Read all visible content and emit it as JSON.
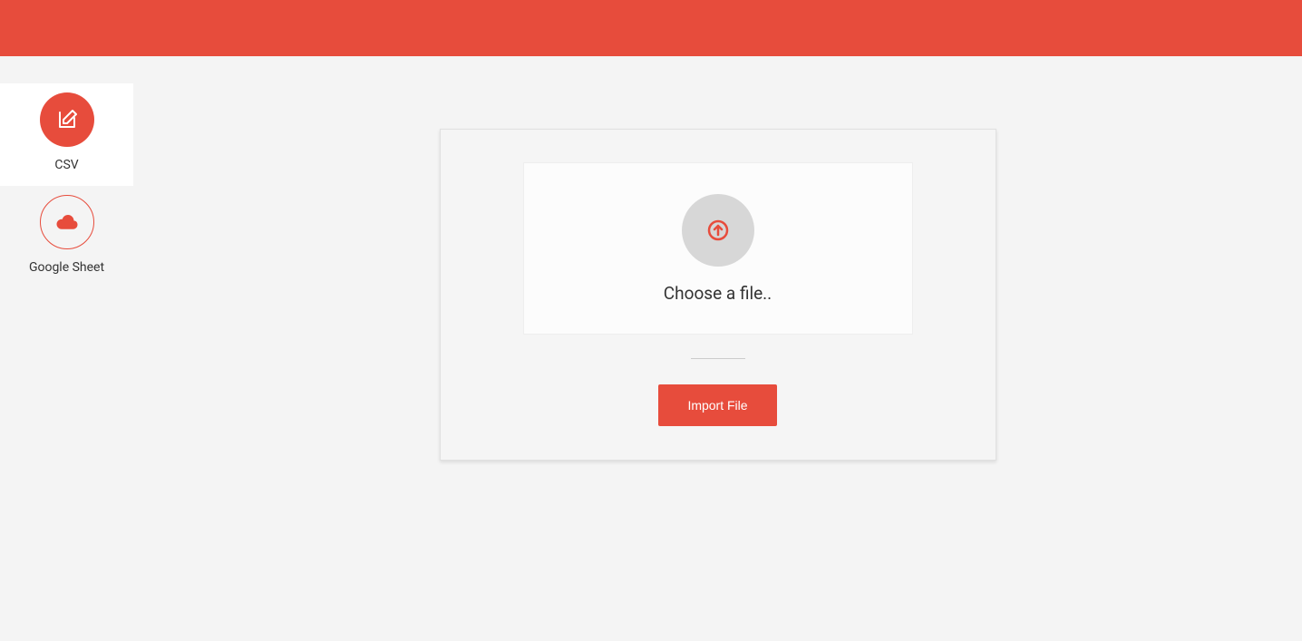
{
  "colors": {
    "accent": "#e74c3c",
    "background": "#f4f4f4"
  },
  "sidebar": {
    "items": [
      {
        "label": "CSV",
        "icon": "edit-icon",
        "active": true
      },
      {
        "label": "Google Sheet",
        "icon": "cloud-icon",
        "active": false
      }
    ]
  },
  "upload": {
    "choose_file_label": "Choose a file..",
    "import_button_label": "Import File"
  }
}
